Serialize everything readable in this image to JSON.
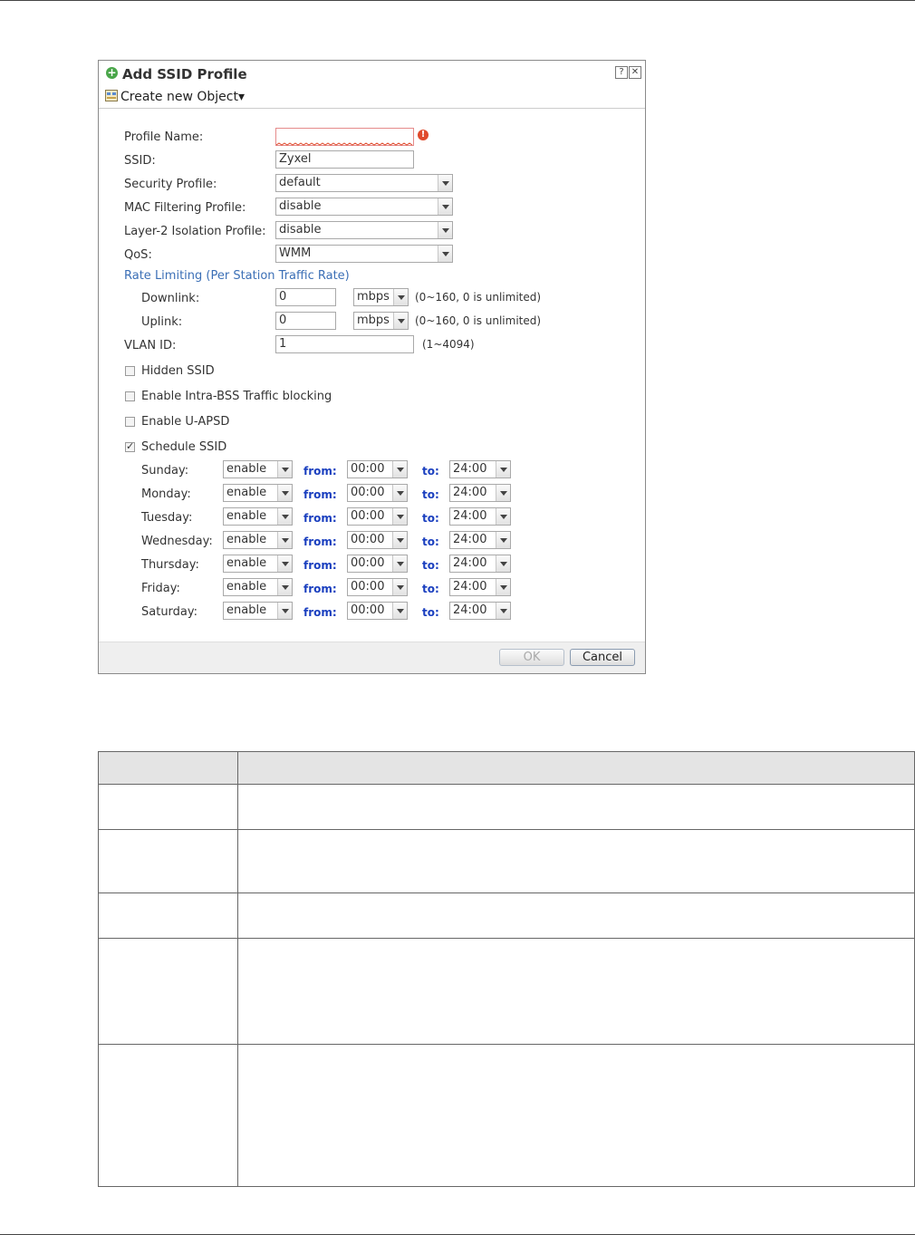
{
  "dialog": {
    "title": "Add SSID Profile",
    "help_btn": "?",
    "close_btn": "✕",
    "toolbar_label": "Create new Object▾",
    "fields": {
      "profile_name": {
        "label": "Profile Name:",
        "value": ""
      },
      "ssid": {
        "label": "SSID:",
        "value": "Zyxel"
      },
      "security_profile": {
        "label": "Security Profile:",
        "value": "default"
      },
      "mac_filter": {
        "label": "MAC Filtering Profile:",
        "value": "disable"
      },
      "l2_isolation": {
        "label": "Layer-2 Isolation Profile:",
        "value": "disable"
      },
      "qos": {
        "label": "QoS:",
        "value": "WMM"
      }
    },
    "rate_limit": {
      "section_label": "Rate Limiting (Per Station Traffic Rate)",
      "downlink": {
        "label": "Downlink:",
        "value": "0",
        "unit": "mbps",
        "note": "(0~160, 0 is unlimited)"
      },
      "uplink": {
        "label": "Uplink:",
        "value": "0",
        "unit": "mbps",
        "note": "(0~160, 0 is unlimited)"
      }
    },
    "vlan": {
      "label": "VLAN ID:",
      "value": "1",
      "note": "(1~4094)"
    },
    "checkboxes": [
      {
        "label": "Hidden SSID",
        "checked": false
      },
      {
        "label": "Enable Intra-BSS Traffic blocking",
        "checked": false
      },
      {
        "label": "Enable U-APSD",
        "checked": false
      },
      {
        "label": "Schedule SSID",
        "checked": true
      }
    ],
    "from_label": "from:",
    "to_label": "to:",
    "schedule": [
      {
        "day": "Sunday:",
        "state": "enable",
        "from": "00:00",
        "to": "24:00"
      },
      {
        "day": "Monday:",
        "state": "enable",
        "from": "00:00",
        "to": "24:00"
      },
      {
        "day": "Tuesday:",
        "state": "enable",
        "from": "00:00",
        "to": "24:00"
      },
      {
        "day": "Wednesday:",
        "state": "enable",
        "from": "00:00",
        "to": "24:00"
      },
      {
        "day": "Thursday:",
        "state": "enable",
        "from": "00:00",
        "to": "24:00"
      },
      {
        "day": "Friday:",
        "state": "enable",
        "from": "00:00",
        "to": "24:00"
      },
      {
        "day": "Saturday:",
        "state": "enable",
        "from": "00:00",
        "to": "24:00"
      }
    ],
    "ok_label": "OK",
    "cancel_label": "Cancel"
  }
}
